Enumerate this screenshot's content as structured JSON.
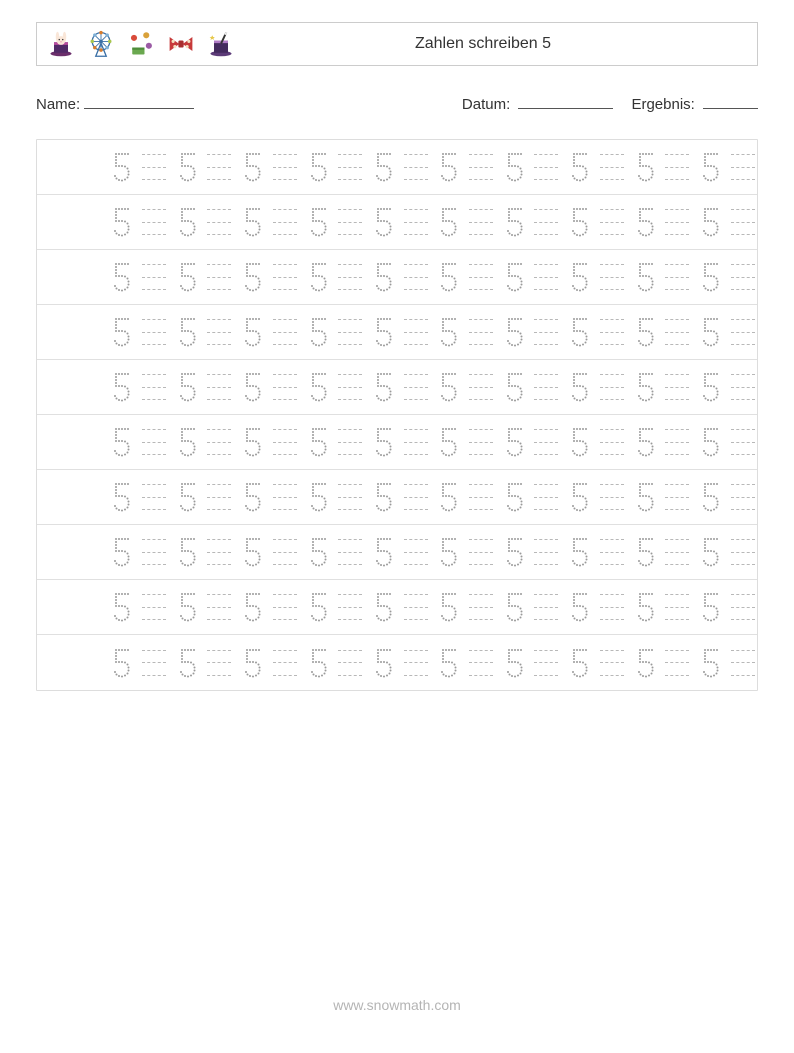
{
  "header": {
    "title": "Zahlen schreiben 5",
    "icons": [
      "magic-hat-rabbit-icon",
      "ferris-wheel-icon",
      "juggling-icon",
      "bowtie-icon",
      "magic-hat-wand-icon"
    ]
  },
  "meta": {
    "name_label": "Name:",
    "date_label": "Datum:",
    "result_label": "Ergebnis:"
  },
  "worksheet": {
    "digit": "5",
    "rows": 10,
    "digit_pairs_per_row": 10
  },
  "footer": {
    "url": "www.snowmath.com"
  },
  "colors": {
    "border": "#cccccc",
    "row_border": "#e0e0e0",
    "dashed": "#b8b8b8",
    "digit_dot": "#9a9a9a",
    "text": "#333333"
  }
}
